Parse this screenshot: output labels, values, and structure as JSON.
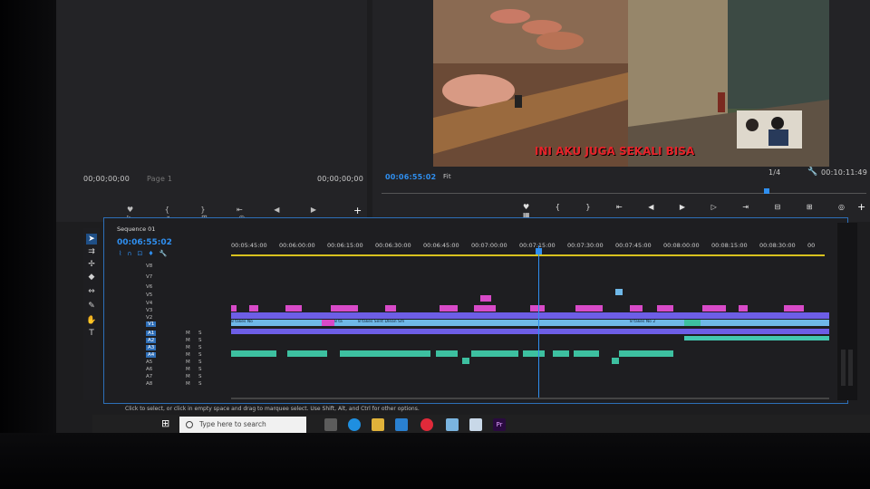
{
  "source_monitor": {
    "timecode_left": "00;00;00;00",
    "timecode_right": "00;00;00;00",
    "page_label": "Page 1"
  },
  "program_monitor": {
    "timecode": "00:06:55:02",
    "fit": "Fit",
    "scale": "1/4",
    "duration": "00:10:11:49",
    "caption": "INI AKU JUGA SEKALI BISA"
  },
  "timeline": {
    "sequence_name": "Sequence 01",
    "timecode": "00:06:55:02",
    "ruler": [
      "00:05:45:00",
      "00:06:00:00",
      "00:06:15:00",
      "00:06:30:00",
      "00:06:45:00",
      "00:07:00:00",
      "00:07:15:00",
      "00:07:30:00",
      "00:07:45:00",
      "00:08:00:00",
      "00:08:15:00",
      "00:08:30:00",
      "00"
    ],
    "video_tracks": [
      "V8",
      "V7",
      "V6",
      "V5",
      "V4",
      "V3",
      "V2",
      "V1"
    ],
    "audio_tracks": [
      "A1",
      "A2",
      "A3",
      "A4",
      "A5",
      "A6",
      "A7",
      "A8"
    ],
    "audio_flags": [
      "M",
      "S"
    ],
    "clip_labels": [
      "8 takes No",
      "8 ta",
      "8 takes Sent Dlean Sm",
      "8 takes No 2"
    ]
  },
  "status_bar": "Click to select, or click in empty space and drag to marquee select. Use Shift, Alt, and Ctrl for other options.",
  "taskbar": {
    "search_placeholder": "Type here to search"
  },
  "colors": {
    "accent": "#2f8ff0",
    "video_clip": "#6d5ee6",
    "pink_clip": "#d84ac8",
    "audio_clip": "#3dc0a0"
  }
}
